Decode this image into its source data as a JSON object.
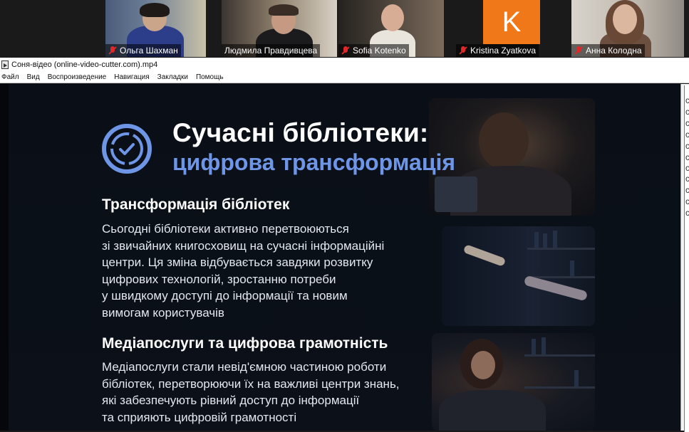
{
  "participants": [
    {
      "name": "Ольга Шахман",
      "muted": true,
      "active": false
    },
    {
      "name": "Людмила Правдивцева",
      "muted": false,
      "active": true
    },
    {
      "name": "Sofia Kotenko",
      "muted": true,
      "active": false
    },
    {
      "name": "Kristina Zyatkova",
      "muted": true,
      "active": false,
      "avatar_letter": "K",
      "avatar_color": "#f07818"
    },
    {
      "name": "Анна Колодна",
      "muted": true,
      "active": false
    }
  ],
  "player": {
    "title": "Соня-відео (online-video-cutter.com).mp4",
    "menu": [
      "Файл",
      "Вид",
      "Воспроизведение",
      "Навигация",
      "Закладки",
      "Помощь"
    ]
  },
  "slide": {
    "title": "Сучасні бібліотеки:",
    "subtitle": "цифрова трансформація",
    "accent_color": "#6e95e6",
    "sections": [
      {
        "heading": "Трансформація бібліотек",
        "lines": [
          "Сьогодні бібліотеки активно перетвоюються",
          "зі звичайних книгосховищ на сучасні інформаційні",
          "центри. Ця зміна відбувається завдяки розвитку",
          "цифрових технологій, зростанню потреби",
          "у швидкому доступі до інформації та новим",
          "вимогам користувачів"
        ]
      },
      {
        "heading": "Медіапослуги та цифрова грамотність",
        "lines": [
          "Медіапослуги стали невід'ємною частиною роботи",
          "бібліотек, перетворюючи їх на важливі центри знань,",
          "які забезпечують рівний доступ до інформації",
          "та сприяють цифровій грамотності"
        ]
      }
    ]
  },
  "side_panel": {
    "chars": [
      "C",
      "C",
      "C",
      "C",
      "C",
      "C",
      "C",
      "C",
      "C",
      "C",
      "C",
      "1",
      "1"
    ]
  }
}
